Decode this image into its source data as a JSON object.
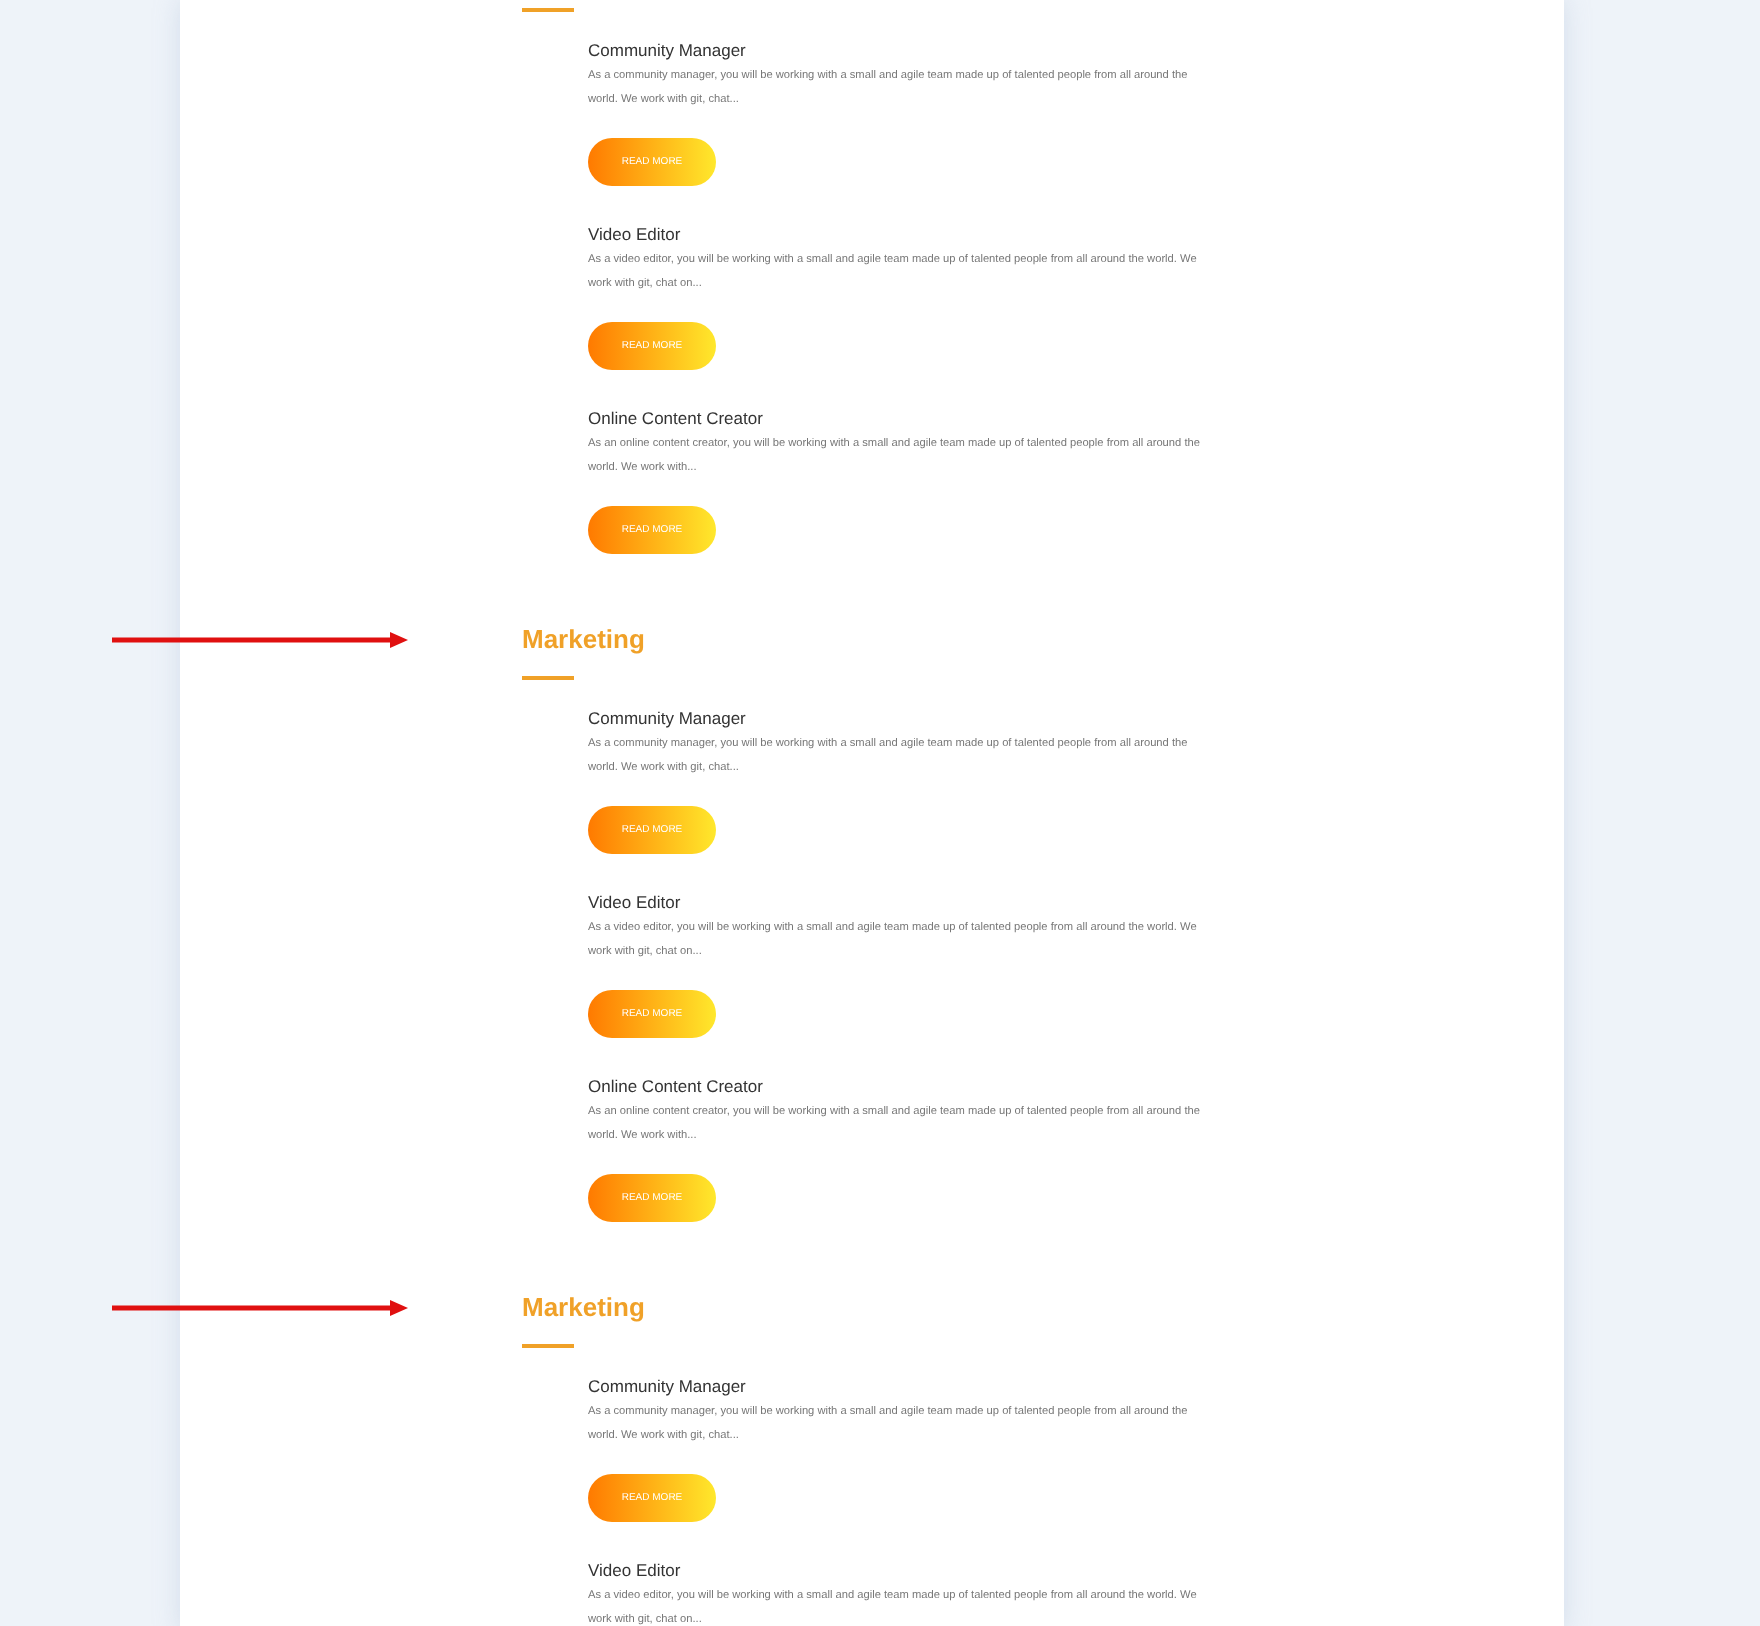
{
  "sections": [
    {
      "arrow": false,
      "jobs": [
        {
          "title": "Community Manager",
          "description": "As a community manager, you will be working with a small and agile team made up of talented people from all around the world. We work with git, chat...",
          "button": "READ MORE"
        },
        {
          "title": "Video Editor",
          "description": "As a video editor, you will be working with a small and agile team made up of talented people from all around the world. We work with git, chat on...",
          "button": "READ MORE"
        },
        {
          "title": "Online Content Creator",
          "description": "As an online content creator, you will be working with a small and agile team made up of talented people from all around the world. We work with...",
          "button": "READ MORE"
        }
      ]
    },
    {
      "heading": "Marketing",
      "arrow": true,
      "jobs": [
        {
          "title": "Community Manager",
          "description": "As a community manager, you will be working with a small and agile team made up of talented people from all around the world. We work with git, chat...",
          "button": "READ MORE"
        },
        {
          "title": "Video Editor",
          "description": "As a video editor, you will be working with a small and agile team made up of talented people from all around the world. We work with git, chat on...",
          "button": "READ MORE"
        },
        {
          "title": "Online Content Creator",
          "description": "As an online content creator, you will be working with a small and agile team made up of talented people from all around the world. We work with...",
          "button": "READ MORE"
        }
      ]
    },
    {
      "heading": "Marketing",
      "arrow": true,
      "jobs": [
        {
          "title": "Community Manager",
          "description": "As a community manager, you will be working with a small and agile team made up of talented people from all around the world. We work with git, chat...",
          "button": "READ MORE"
        },
        {
          "title": "Video Editor",
          "description": "As a video editor, you will be working with a small and agile team made up of talented people from all around the world. We work with git, chat on..."
        }
      ]
    }
  ]
}
